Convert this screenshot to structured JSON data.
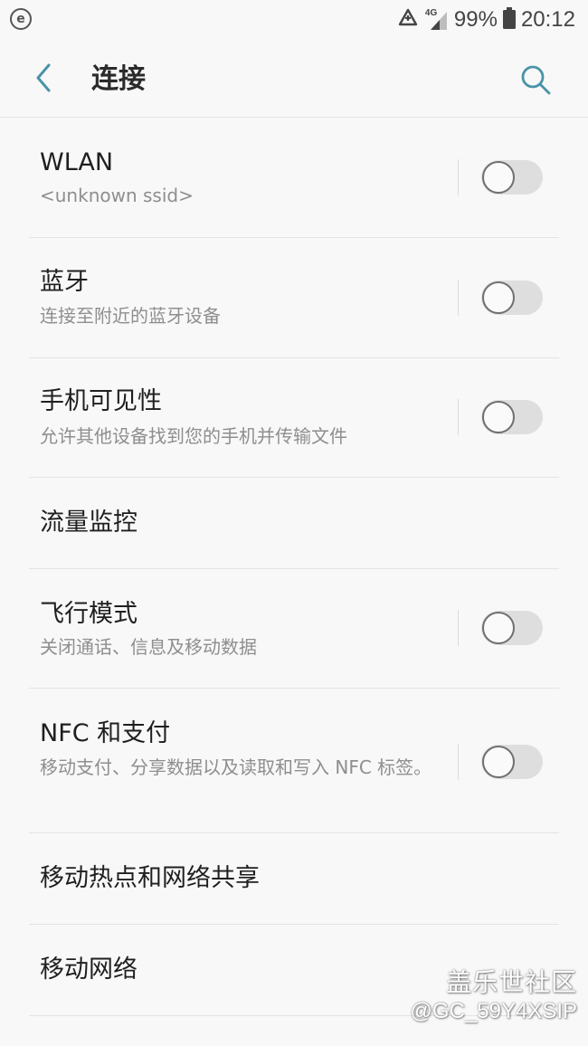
{
  "status_bar": {
    "notification_icon_letter": "e",
    "network_label": "4G",
    "battery": "99%",
    "time": "20:12"
  },
  "header": {
    "title": "连接"
  },
  "items": [
    {
      "title": "WLAN",
      "subtitle": "<unknown ssid>",
      "has_toggle": true,
      "toggle_on": false
    },
    {
      "title": "蓝牙",
      "subtitle": "连接至附近的蓝牙设备",
      "has_toggle": true,
      "toggle_on": false
    },
    {
      "title": "手机可见性",
      "subtitle": "允许其他设备找到您的手机并传输文件",
      "has_toggle": true,
      "toggle_on": false
    },
    {
      "title": "流量监控",
      "has_toggle": false
    },
    {
      "title": "飞行模式",
      "subtitle": "关闭通话、信息及移动数据",
      "has_toggle": true,
      "toggle_on": false
    },
    {
      "title": "NFC 和支付",
      "subtitle": "移动支付、分享数据以及读取和写入 NFC 标签。",
      "has_toggle": true,
      "toggle_on": false
    },
    {
      "title": "移动热点和网络共享",
      "has_toggle": false
    },
    {
      "title": "移动网络",
      "has_toggle": false
    }
  ],
  "watermark": {
    "brand": "盖乐世社区",
    "user": "@GC_59Y4XSIP"
  },
  "colors": {
    "accent": "#4a93a8",
    "background": "#f8f8f8",
    "toggle_track_off": "#dedede",
    "toggle_knob_border": "#6f6f6f"
  }
}
